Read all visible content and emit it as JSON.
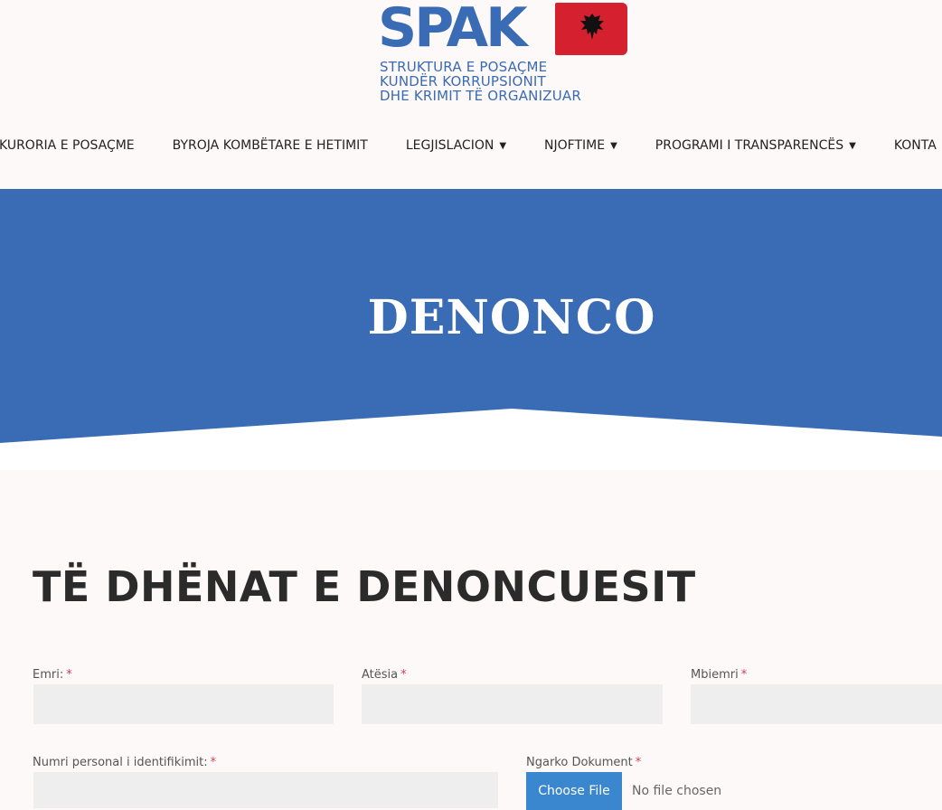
{
  "logo": {
    "text": "SPAK",
    "subtitle": [
      "STRUKTURA E POSAÇME",
      "KUNDËR KORRUPSIONIT",
      "DHE KRIMIT TË ORGANIZUAR"
    ]
  },
  "nav": {
    "items": [
      {
        "label": "OKURORIA E POSAÇME",
        "dropdown": false
      },
      {
        "label": "BYROJA KOMBËTARE E HETIMIT",
        "dropdown": false
      },
      {
        "label": "LEGJISLACION",
        "dropdown": true
      },
      {
        "label": "NJOFTIME",
        "dropdown": true
      },
      {
        "label": "PROGRAMI I TRANSPARENCËS",
        "dropdown": true
      },
      {
        "label": "KONTA",
        "dropdown": false
      }
    ]
  },
  "hero": {
    "title": "DENONCO"
  },
  "form": {
    "section_title": "TË DHËNAT E DENONCUESIT",
    "required_marker": "*",
    "fields": {
      "emri": {
        "label": "Emri:",
        "value": ""
      },
      "atesia": {
        "label": "Atësia",
        "value": ""
      },
      "mbiemri": {
        "label": "Mbiemri",
        "value": ""
      },
      "nid": {
        "label": "Numri personal i identifikimit:",
        "value": ""
      },
      "document": {
        "label": "Ngarko Dokument",
        "button": "Choose File",
        "status": "No file chosen"
      }
    }
  },
  "colors": {
    "brand_blue": "#3a6bb5",
    "hero_blue": "#3a6bb5",
    "flag_red": "#d4202f",
    "required": "#d43a5a",
    "button_blue": "#3a86cf"
  }
}
